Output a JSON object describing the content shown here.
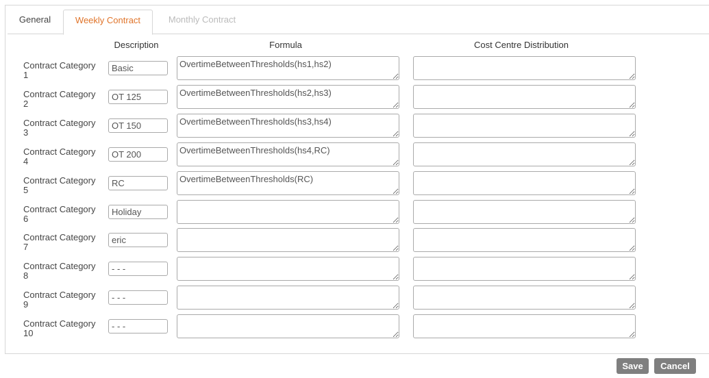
{
  "tabs": [
    {
      "label": "General"
    },
    {
      "label": "Weekly Contract"
    },
    {
      "label": "Monthly Contract"
    }
  ],
  "columns": {
    "description": "Description",
    "formula": "Formula",
    "cost_centre": "Cost Centre Distribution"
  },
  "rows": [
    {
      "label_line1": "Contract Category",
      "label_line2": "1",
      "description": "Basic",
      "formula": "OvertimeBetweenThresholds(hs1,hs2)",
      "cost_centre": ""
    },
    {
      "label_line1": "Contract Category",
      "label_line2": "2",
      "description": "OT 125",
      "formula": "OvertimeBetweenThresholds(hs2,hs3)",
      "cost_centre": ""
    },
    {
      "label_line1": "Contract Category",
      "label_line2": "3",
      "description": "OT 150",
      "formula": "OvertimeBetweenThresholds(hs3,hs4)",
      "cost_centre": ""
    },
    {
      "label_line1": "Contract Category",
      "label_line2": "4",
      "description": "OT 200",
      "formula": "OvertimeBetweenThresholds(hs4,RC)",
      "cost_centre": ""
    },
    {
      "label_line1": "Contract Category",
      "label_line2": "5",
      "description": "RC",
      "formula": "OvertimeBetweenThresholds(RC)",
      "cost_centre": ""
    },
    {
      "label_line1": "Contract Category",
      "label_line2": "6",
      "description": "Holiday",
      "formula": "",
      "cost_centre": ""
    },
    {
      "label_line1": "Contract Category",
      "label_line2": "7",
      "description": "eric",
      "formula": "",
      "cost_centre": ""
    },
    {
      "label_line1": "Contract Category",
      "label_line2": "8",
      "description": "- - -",
      "formula": "",
      "cost_centre": ""
    },
    {
      "label_line1": "Contract Category",
      "label_line2": "9",
      "description": "- - -",
      "formula": "",
      "cost_centre": ""
    },
    {
      "label_line1": "Contract Category",
      "label_line2": "10",
      "description": "- - -",
      "formula": "",
      "cost_centre": ""
    }
  ],
  "buttons": {
    "save": "Save",
    "cancel": "Cancel"
  },
  "colors": {
    "active_tab": "#e0742a",
    "inactive_tab": "#bbbbbb",
    "button_bg": "#7f7f7f"
  }
}
